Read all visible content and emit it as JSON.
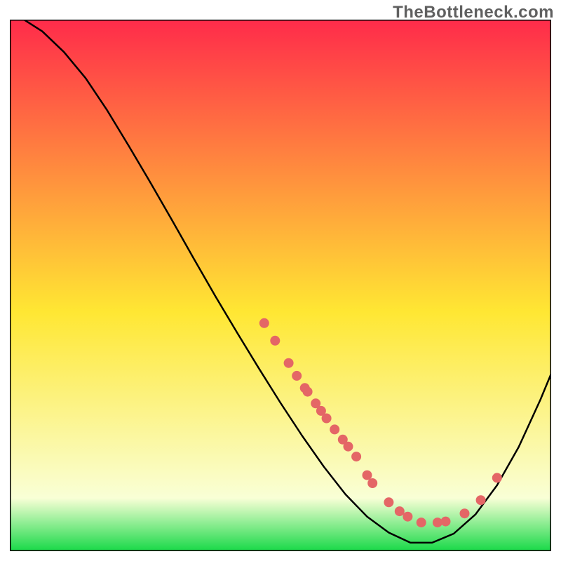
{
  "watermark": "TheBottleneck.com",
  "colors": {
    "gradient_top": "#ff2b4a",
    "gradient_mid": "#ffe733",
    "gradient_low": "#f9ffd6",
    "gradient_bottom": "#18d948",
    "curve": "#000000",
    "dot_fill": "#e46666",
    "dot_stroke": "#e46666",
    "frame": "#000000"
  },
  "chart_data": {
    "type": "line",
    "title": "",
    "xlabel": "",
    "ylabel": "",
    "xlim": [
      0,
      100
    ],
    "ylim": [
      0,
      100
    ],
    "grid": false,
    "legend_position": "none",
    "curve": [
      {
        "x": 2.6,
        "y": 100.0
      },
      {
        "x": 6.0,
        "y": 97.8
      },
      {
        "x": 10.0,
        "y": 93.9
      },
      {
        "x": 14.0,
        "y": 89.0
      },
      {
        "x": 18.0,
        "y": 82.9
      },
      {
        "x": 22.0,
        "y": 76.2
      },
      {
        "x": 26.0,
        "y": 69.3
      },
      {
        "x": 30.0,
        "y": 62.2
      },
      {
        "x": 34.0,
        "y": 55.0
      },
      {
        "x": 38.0,
        "y": 47.9
      },
      {
        "x": 42.0,
        "y": 41.1
      },
      {
        "x": 46.0,
        "y": 34.4
      },
      {
        "x": 50.0,
        "y": 27.9
      },
      {
        "x": 54.0,
        "y": 21.7
      },
      {
        "x": 58.0,
        "y": 15.9
      },
      {
        "x": 62.0,
        "y": 10.7
      },
      {
        "x": 66.0,
        "y": 6.5
      },
      {
        "x": 70.0,
        "y": 3.5
      },
      {
        "x": 74.0,
        "y": 1.6
      },
      {
        "x": 78.0,
        "y": 1.6
      },
      {
        "x": 82.0,
        "y": 3.3
      },
      {
        "x": 86.0,
        "y": 6.9
      },
      {
        "x": 90.0,
        "y": 12.4
      },
      {
        "x": 94.0,
        "y": 19.6
      },
      {
        "x": 98.0,
        "y": 28.5
      },
      {
        "x": 100.0,
        "y": 33.4
      }
    ],
    "dots": [
      {
        "x": 47.0,
        "y": 42.9
      },
      {
        "x": 49.0,
        "y": 39.6
      },
      {
        "x": 51.5,
        "y": 35.4
      },
      {
        "x": 53.0,
        "y": 33.0
      },
      {
        "x": 54.5,
        "y": 30.7
      },
      {
        "x": 55.0,
        "y": 30.0
      },
      {
        "x": 56.5,
        "y": 27.8
      },
      {
        "x": 57.5,
        "y": 26.4
      },
      {
        "x": 58.5,
        "y": 25.0
      },
      {
        "x": 60.0,
        "y": 22.9
      },
      {
        "x": 61.5,
        "y": 21.0
      },
      {
        "x": 62.5,
        "y": 19.7
      },
      {
        "x": 64.0,
        "y": 17.8
      },
      {
        "x": 66.0,
        "y": 14.3
      },
      {
        "x": 67.0,
        "y": 12.8
      },
      {
        "x": 70.0,
        "y": 9.2
      },
      {
        "x": 72.0,
        "y": 7.5
      },
      {
        "x": 73.5,
        "y": 6.5
      },
      {
        "x": 76.0,
        "y": 5.4
      },
      {
        "x": 79.0,
        "y": 5.4
      },
      {
        "x": 80.5,
        "y": 5.6
      },
      {
        "x": 84.0,
        "y": 7.1
      },
      {
        "x": 87.0,
        "y": 9.6
      },
      {
        "x": 90.0,
        "y": 13.8
      }
    ]
  }
}
